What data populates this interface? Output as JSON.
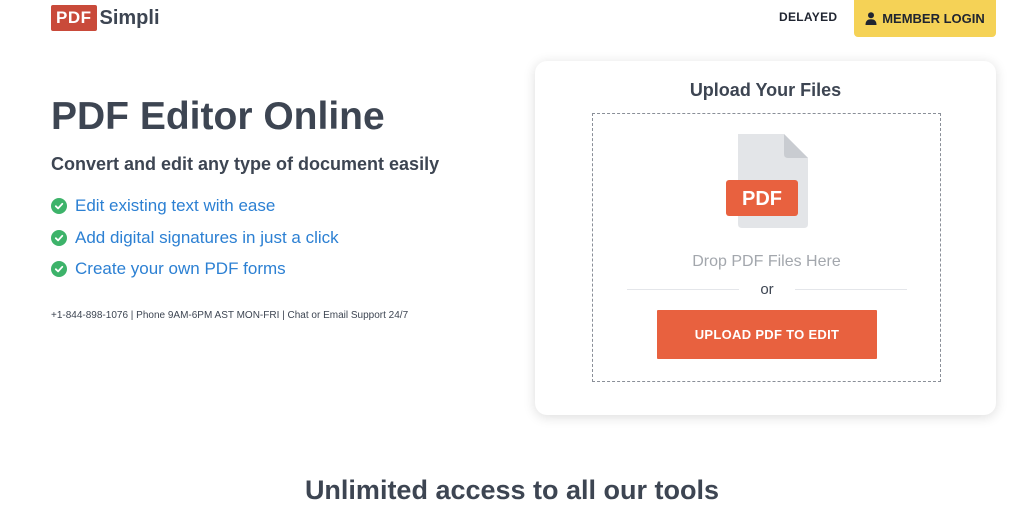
{
  "header": {
    "logo_box": "PDF",
    "logo_text": "Simpli",
    "delayed_label": "DELAYED",
    "member_login_label": "MEMBER LOGIN"
  },
  "hero": {
    "title": "PDF Editor Online",
    "subtitle": "Convert and edit any type of document easily",
    "features": [
      {
        "label": "Edit existing text with ease",
        "icon": "check-circle-icon"
      },
      {
        "label": "Add digital signatures in just a click",
        "icon": "check-circle-icon"
      },
      {
        "label": "Create your own PDF forms",
        "icon": "check-circle-icon"
      }
    ],
    "support_line": "+1-844-898-1076 | Phone 9AM-6PM AST MON-FRI | Chat or Email Support 24/7"
  },
  "upload": {
    "title": "Upload Your Files",
    "file_badge": "PDF",
    "drop_text": "Drop PDF Files Here",
    "or_text": "or",
    "button_label": "UPLOAD PDF TO EDIT"
  },
  "footer": {
    "heading": "Unlimited access to all our tools"
  },
  "colors": {
    "brand_red": "#c94a3a",
    "accent_yellow": "#f5d256",
    "upload_orange": "#e8613f",
    "link_blue": "#2c80d3",
    "check_green": "#3db36a",
    "text_dark": "#3d4552"
  }
}
